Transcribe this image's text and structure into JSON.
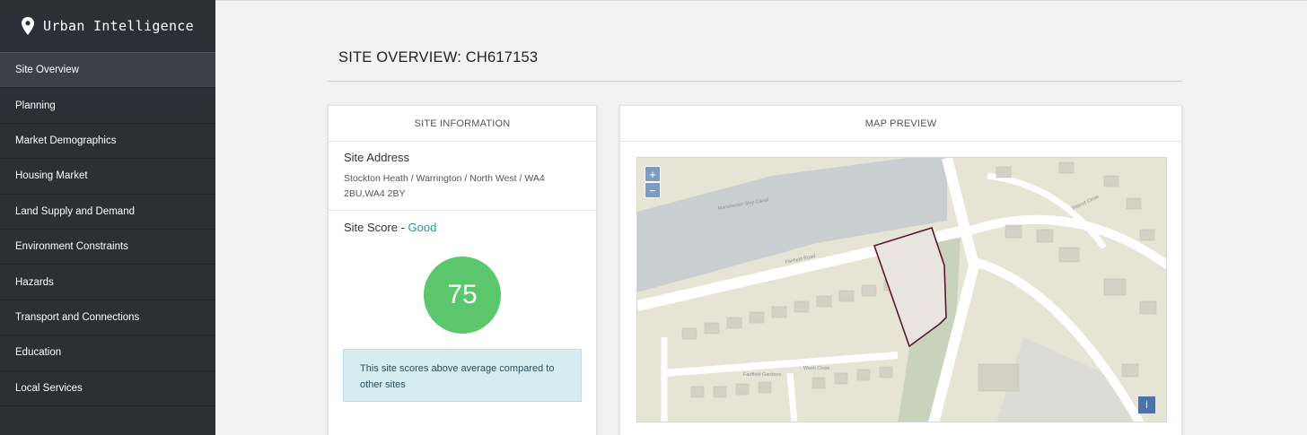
{
  "brand": {
    "name": "Urban Intelligence",
    "icon": "map-pin-icon"
  },
  "sidebar": {
    "items": [
      {
        "label": "Site Overview",
        "active": true
      },
      {
        "label": "Planning"
      },
      {
        "label": "Market Demographics"
      },
      {
        "label": "Housing Market"
      },
      {
        "label": "Land Supply and Demand"
      },
      {
        "label": "Environment Constraints"
      },
      {
        "label": "Hazards"
      },
      {
        "label": "Transport and Connections"
      },
      {
        "label": "Education"
      },
      {
        "label": "Local Services"
      }
    ]
  },
  "page": {
    "title": "SITE OVERVIEW: CH617153"
  },
  "site_info": {
    "header": "SITE INFORMATION",
    "address_title": "Site Address",
    "address": "Stockton Heath / Warrington / North West / WA4 2BU,WA4 2BY",
    "score_label": "Site Score - ",
    "score_rating": "Good",
    "score_value": "75",
    "score_note": "This site scores above average compared to other sites",
    "colors": {
      "score_circle": "#5cc66d",
      "rating_text": "#1f99a4",
      "note_bg": "#d5ecf1"
    }
  },
  "map": {
    "header": "MAP PREVIEW",
    "zoom_in": "+",
    "zoom_out": "−",
    "info": "i",
    "labels": {
      "road_1": "Fairfield Road",
      "road_2": "Fairfield Gardens",
      "road_3": "Wash Close",
      "water": "Manchester Ship Canal",
      "road_4": "Walnut Close"
    },
    "site_outline_color": "#5a1734"
  }
}
